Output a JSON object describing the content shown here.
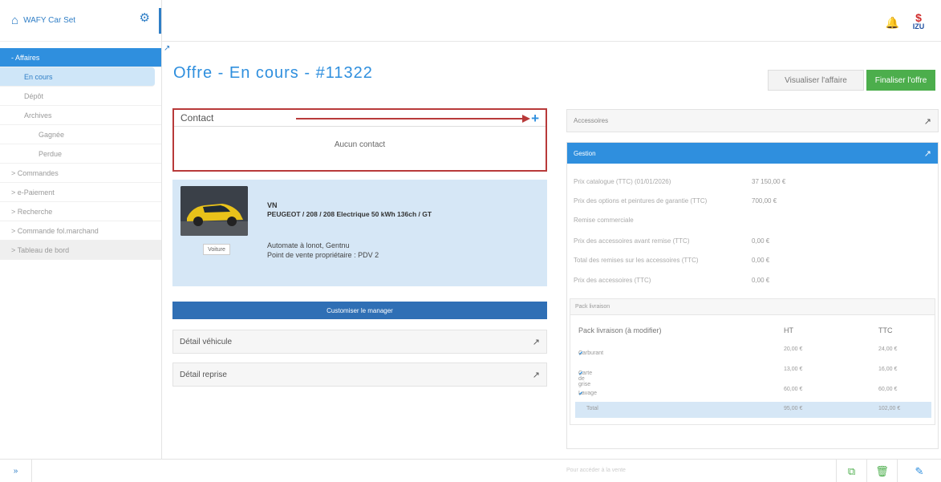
{
  "app": {
    "title": "WAFY Car Set"
  },
  "sidebar": {
    "items": [
      {
        "label": "- Affaires"
      },
      {
        "label": "En cours"
      },
      {
        "label": "Dépôt"
      },
      {
        "label": "Archives"
      },
      {
        "label": "Gagnée"
      },
      {
        "label": "Perdue"
      },
      {
        "label": "> Commandes"
      },
      {
        "label": "> e-Paiement"
      },
      {
        "label": "> Recherche"
      },
      {
        "label": "> Commande fol.marchand"
      },
      {
        "label": "> Tableau de bord"
      }
    ]
  },
  "page": {
    "title": "Offre - En cours - #11322"
  },
  "actions": {
    "view_label": "Visualiser l'affaire",
    "finish_label": "Finaliser l'offre"
  },
  "contact": {
    "title": "Contact",
    "empty": "Aucun contact"
  },
  "vehicle": {
    "type": "VN",
    "model": "PEUGEOT / 208 / 208 Electrique 50 kWh 136ch / GT",
    "line1": "Automate à lonot, Gentnu",
    "line2": "Point de vente propriétaire : PDV 2",
    "badge": "Voiture"
  },
  "config_button": "Customiser le manager",
  "panels": {
    "vehicle_detail": "Détail véhicule",
    "trade_in_detail": "Détail reprise"
  },
  "accessories": {
    "title": "Accessoires"
  },
  "gestion": {
    "title": "Gestion",
    "rows": [
      {
        "label": "Prix catalogue (TTC) (01/01/2026)",
        "value": "37 150,00 €"
      },
      {
        "label": "Prix des options et peintures de garantie (TTC)",
        "value": "700,00 €"
      },
      {
        "label": "Remise commerciale",
        "value": ""
      },
      {
        "label": "Prix des accessoires avant remise (TTC)",
        "value": "0,00 €"
      },
      {
        "label": "Total des remises sur les accessoires (TTC)",
        "value": "0,00 €"
      },
      {
        "label": "Prix des accessoires (TTC)",
        "value": "0,00 €"
      }
    ]
  },
  "pack": {
    "title": "Pack livraison",
    "headers": [
      "Pack livraison (à modifier)",
      "HT",
      "TTC"
    ],
    "rows": [
      {
        "label": "Carburant",
        "ht": "20,00 €",
        "ttc": "24,00 €"
      },
      {
        "label": "Carte de grise",
        "ht": "13,00 €",
        "ttc": "16,00 €"
      },
      {
        "label": "Lavage",
        "ht": "60,00 €",
        "ttc": "60,00 €"
      }
    ],
    "total": {
      "label": "Total",
      "ht": "95,00 €",
      "ttc": "102,00 €"
    }
  },
  "bottom": {
    "hint": "Pour accéder à la vente"
  },
  "colors": {
    "primary": "#2f8fde",
    "success": "#4cae4c",
    "highlight": "#b83a3a"
  }
}
